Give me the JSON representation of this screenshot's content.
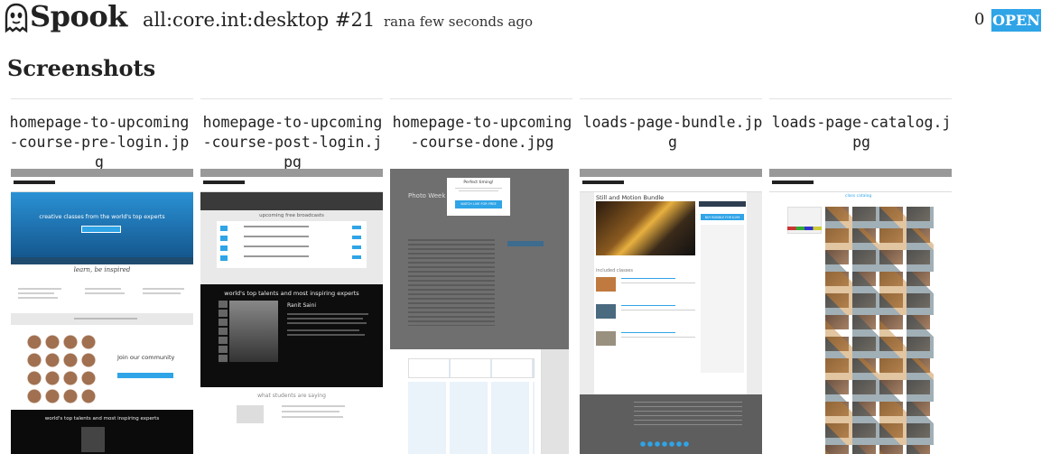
{
  "header": {
    "app_name": "Spook",
    "build_title": "all:core.int:desktop #21",
    "ran_label": "ran",
    "ran_time": "a few seconds ago",
    "count": "0",
    "status": "OPEN"
  },
  "section_title": "Screenshots",
  "colors": {
    "accent": "#2fa4e7",
    "thumb_blue": "#2b9be0",
    "dark": "#111111"
  },
  "screenshots": [
    {
      "name": "homepage-to-upcoming-course-pre-login.jpg",
      "hero_text": "creative classes from the world's top experts",
      "mid_text": "learn, be inspired",
      "community": "Join our community",
      "footer_text": "world's top talents and most inspiring experts"
    },
    {
      "name": "homepage-to-upcoming-course-post-login.jpg",
      "list_title": "upcoming free broadcasts",
      "dark_text": "world's top talents and most inspiring experts",
      "person": "Ranit Saini",
      "bottom_text": "what students are saying"
    },
    {
      "name": "homepage-to-upcoming-course-done.jpg",
      "modal_title": "Perfect timing!",
      "modal_button": "WATCH LIVE FOR FREE",
      "page_title": "Photo Week 2014"
    },
    {
      "name": "loads-page-bundle.jpg",
      "page_title": "Still and Motion Bundle",
      "buy_button": "BUY BUNDLE FOR $199",
      "section": "included classes"
    },
    {
      "name": "loads-page-catalog.jpg",
      "page_title": "class catalog"
    }
  ]
}
